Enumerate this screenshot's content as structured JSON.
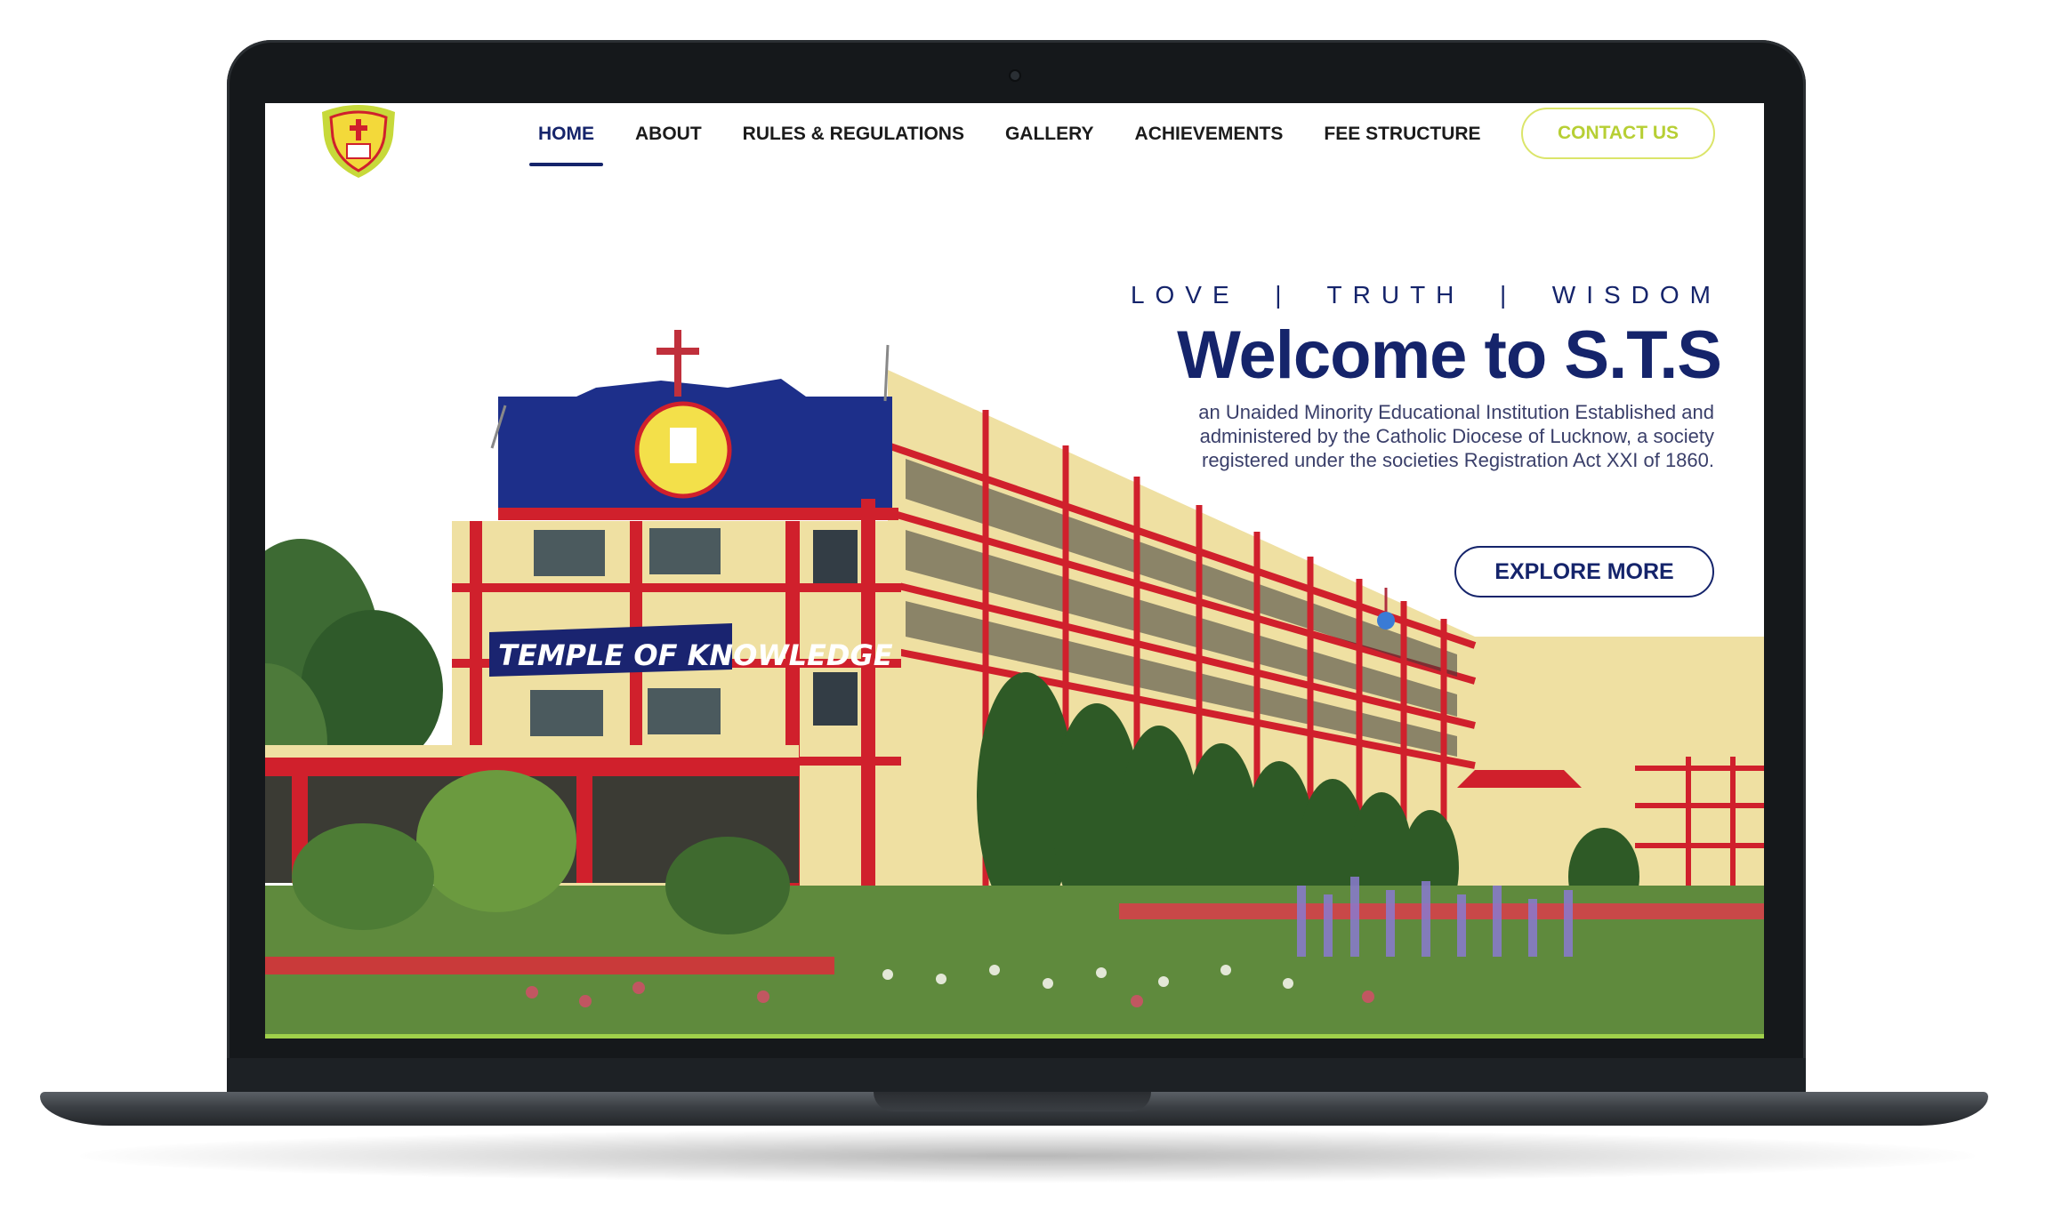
{
  "nav": {
    "items": [
      {
        "label": "HOME",
        "active": true
      },
      {
        "label": "ABOUT"
      },
      {
        "label": "RULES & REGULATIONS"
      },
      {
        "label": "GALLERY"
      },
      {
        "label": "ACHIEVEMENTS"
      },
      {
        "label": "FEE STRUCTURE"
      }
    ],
    "contact_label": "CONTACT US"
  },
  "hero": {
    "tagline": "LOVE  |  TRUTH  |  WISDOM",
    "title": "Welcome to S.T.S",
    "description": "an Unaided Minority Educational Institution Established and administered by the Catholic Diocese of Lucknow, a society registered under the societies Registration Act XXI of 1860.",
    "button_label": "EXPLORE MORE"
  },
  "building": {
    "sign_text": "TEMPLE OF KNOWLEDGE"
  },
  "colors": {
    "primary": "#15246b",
    "accent": "#b7cf34",
    "building_yellow": "#efe0a2",
    "building_red": "#d0202c"
  }
}
